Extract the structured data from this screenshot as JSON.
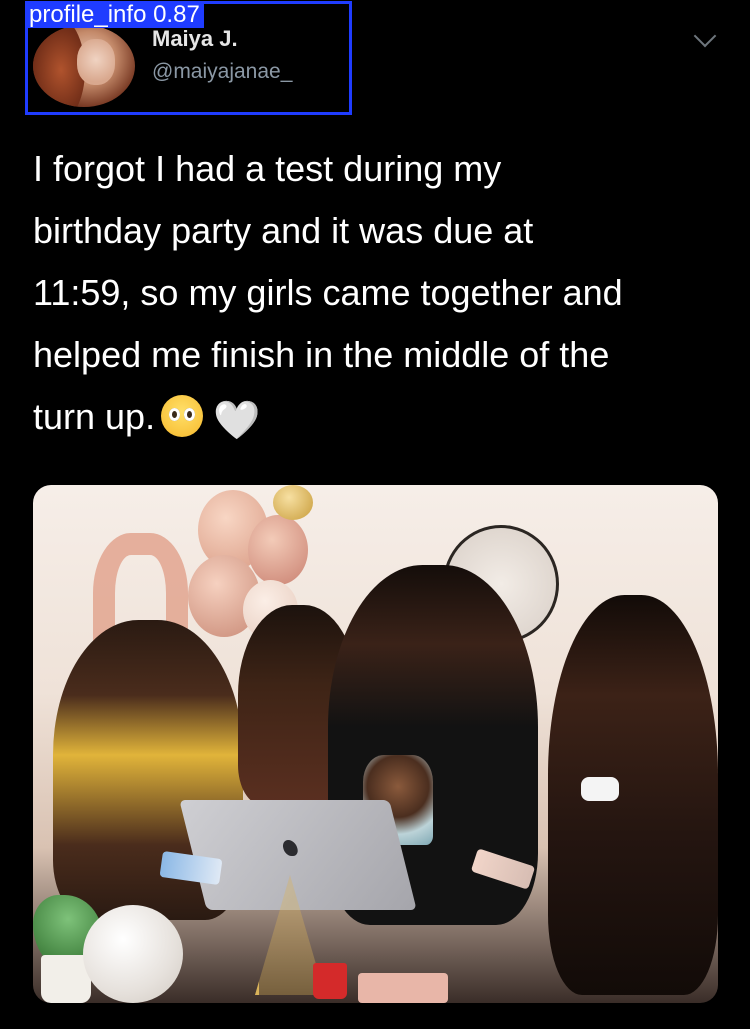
{
  "detector": {
    "label": "profile_info 0.87"
  },
  "author": {
    "display_name": "Maiya J.",
    "handle": "@maiyajanae_"
  },
  "tweet": {
    "text": "I forgot I had a test during my\nbirthday party and it was due at\n11:59, so my girls came together and\nhelped me finish in the middle of the\nturn up.",
    "heart_emoji": "🤍"
  },
  "icons": {
    "more": "chevron-down-icon",
    "emoji_1": "pleading-face-icon",
    "emoji_2": "white-heart-icon"
  }
}
